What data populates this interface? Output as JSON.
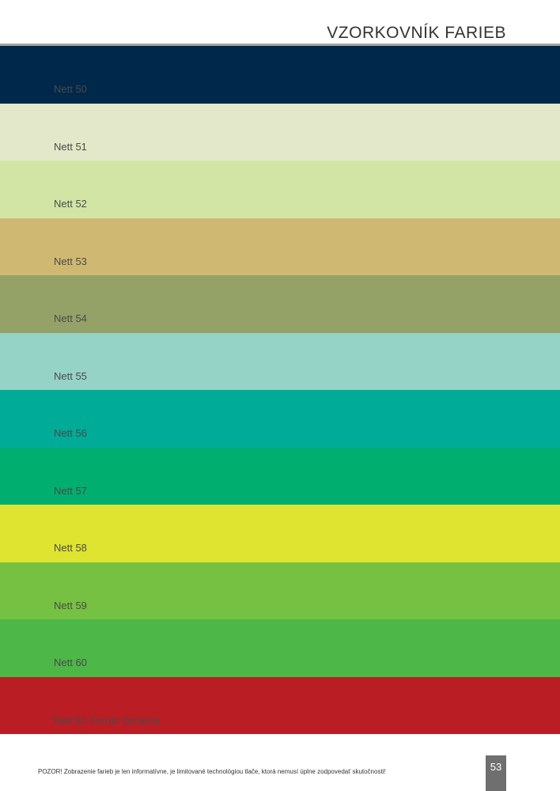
{
  "header": {
    "title": "VZORKOVNÍK FARIEB"
  },
  "swatches": [
    {
      "label": "Nett 50",
      "color": "#00284b"
    },
    {
      "label": "Nett 51",
      "color": "#e2e8c9"
    },
    {
      "label": "Nett 52",
      "color": "#d3e5a5"
    },
    {
      "label": "Nett 53",
      "color": "#cfb972"
    },
    {
      "label": "Nett 54",
      "color": "#94a268"
    },
    {
      "label": "Nett 55",
      "color": "#95d3c7"
    },
    {
      "label": "Nett 56",
      "color": "#00ab98"
    },
    {
      "label": "Nett 57",
      "color": "#00af6f"
    },
    {
      "label": "Nett 58",
      "color": "#dee430"
    },
    {
      "label": "Nett 59",
      "color": "#76c142"
    },
    {
      "label": "Nett 60",
      "color": "#4db748"
    },
    {
      "label": "Nett 61 Ferrari červená",
      "color": "#ba1d24"
    }
  ],
  "footer": {
    "note": "POZOR! Zobrazenie farieb je len informatívne, je limitované technológiou tlače, ktorá nemusí úplne zodpovedať skutočnosti!",
    "page_number": "53"
  }
}
